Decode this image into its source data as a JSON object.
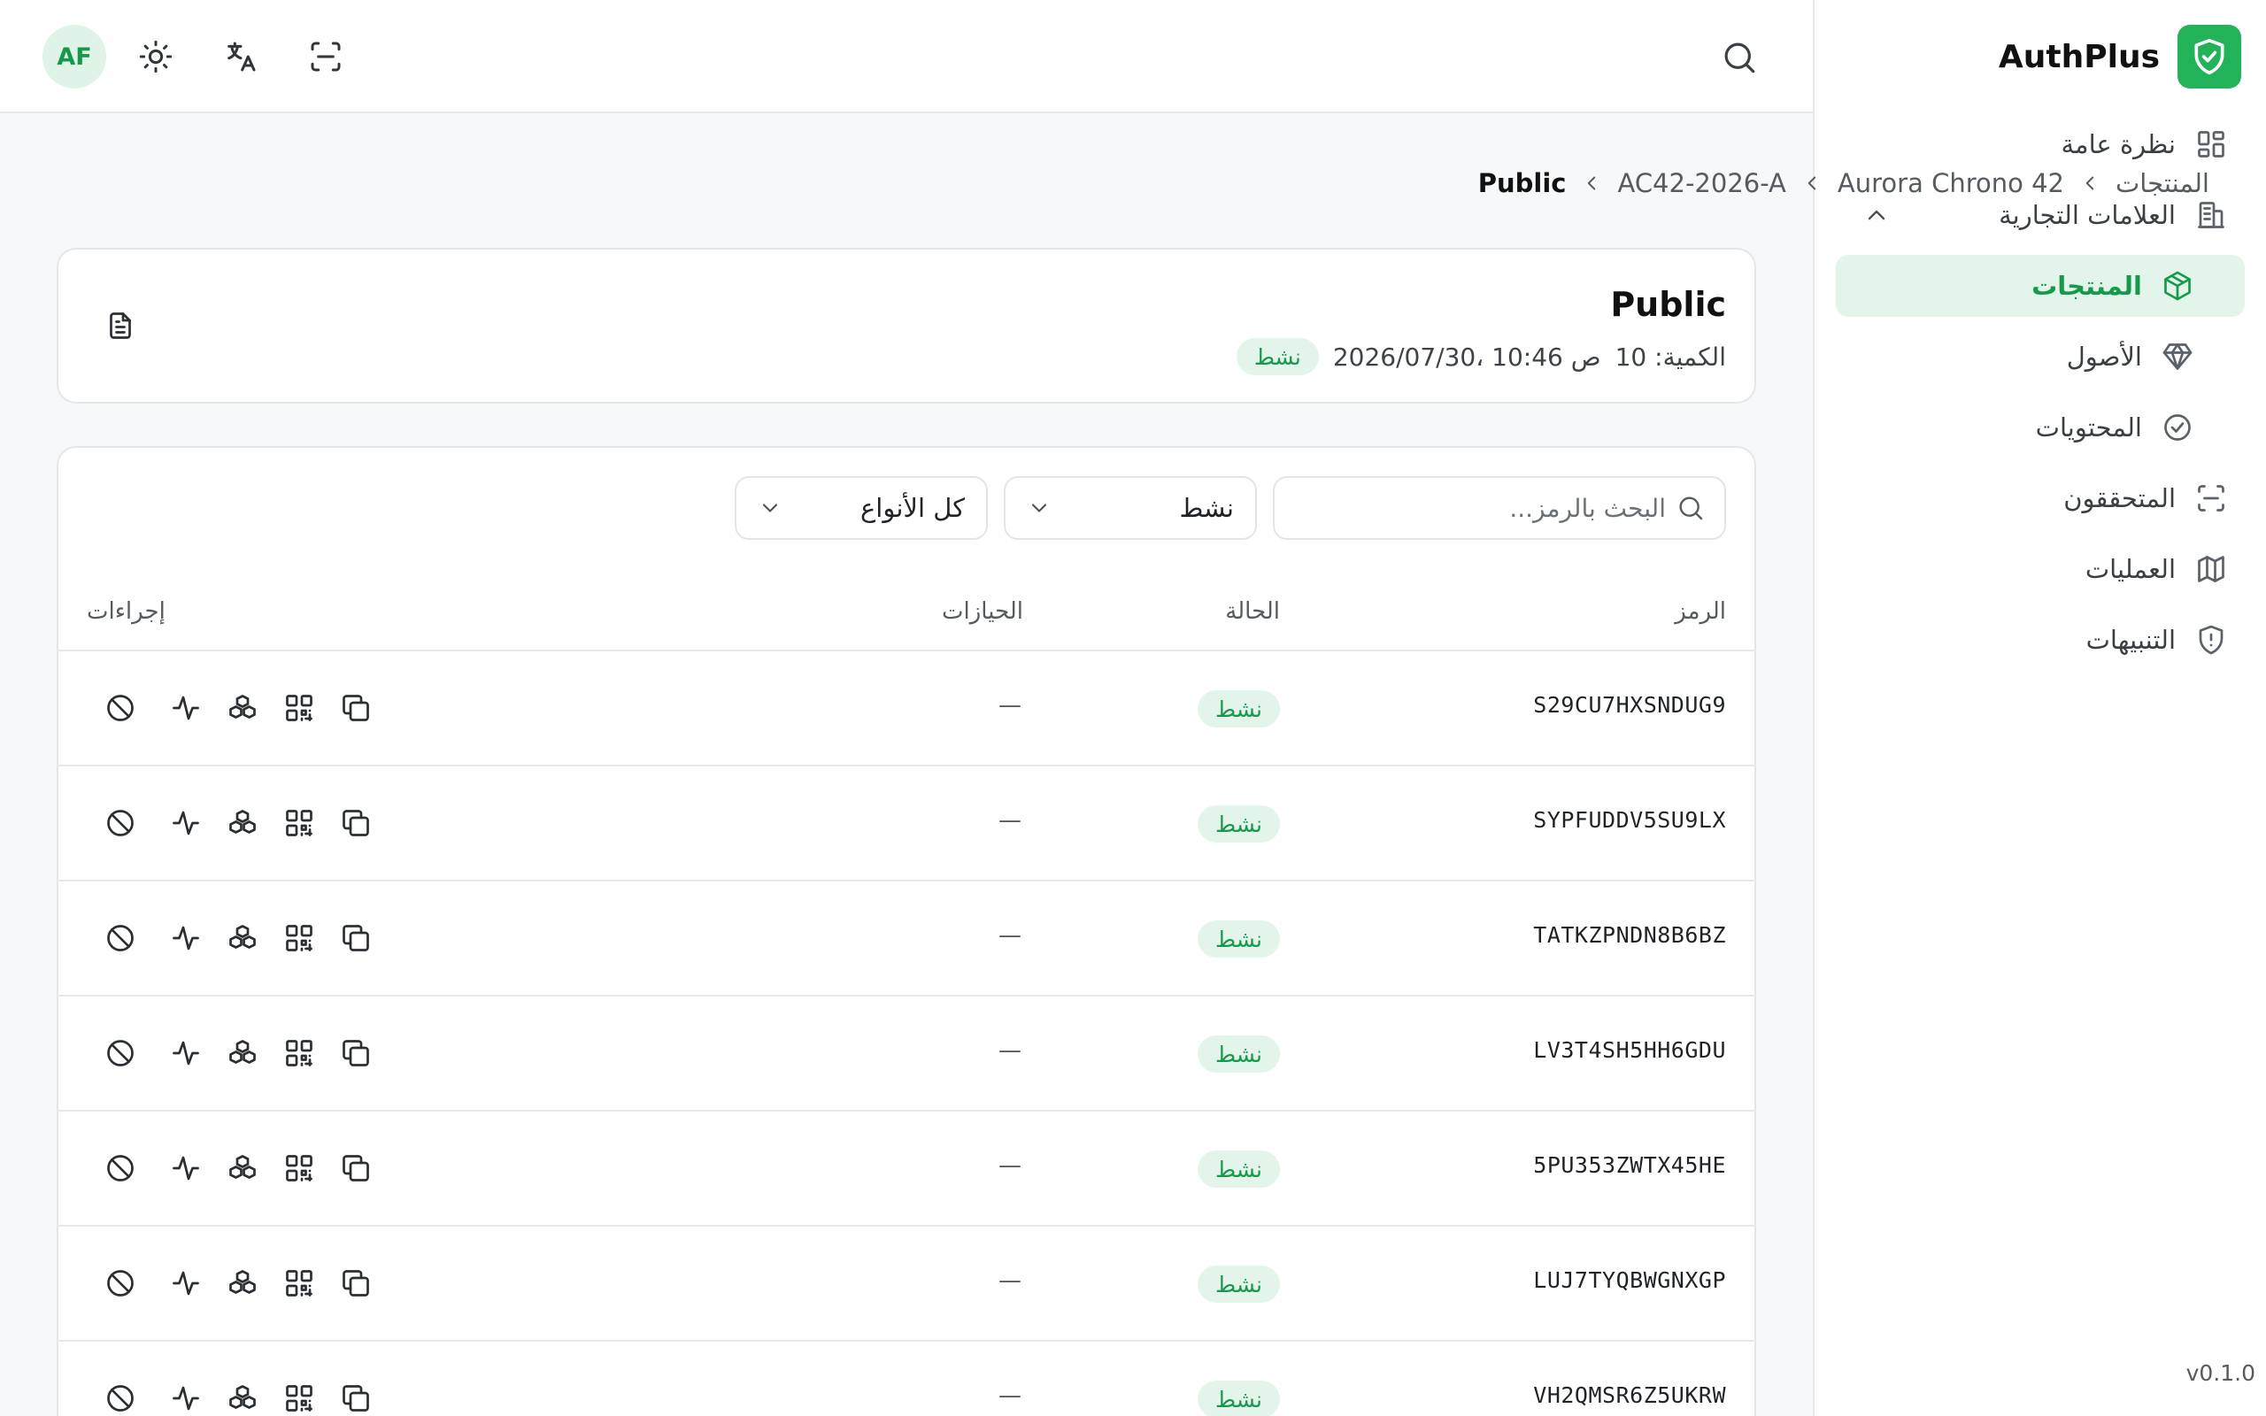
{
  "app": {
    "name": "AuthPlus",
    "version": "v0.1.0"
  },
  "colors": {
    "accent": "#22b25a",
    "accent_text": "#17994c",
    "accent_bg": "#e3f5ea"
  },
  "sidebar": {
    "items": [
      {
        "label": "نظرة عامة",
        "icon": "grid-icon"
      },
      {
        "label": "العلامات التجارية",
        "icon": "building-icon"
      },
      {
        "label": "المنتجات",
        "icon": "box-icon",
        "active": true
      },
      {
        "label": "الأصول",
        "icon": "gem-icon"
      },
      {
        "label": "المحتويات",
        "icon": "check-circle-icon"
      },
      {
        "label": "المتحققون",
        "icon": "scan-icon"
      },
      {
        "label": "العمليات",
        "icon": "map-icon"
      },
      {
        "label": "التنبيهات",
        "icon": "shield-alert-icon"
      }
    ]
  },
  "topbar": {
    "avatar": "AF"
  },
  "breadcrumb": [
    "المنتجات",
    "Aurora Chrono 42",
    "AC42-2026-A",
    "Public"
  ],
  "header": {
    "title": "Public",
    "quantity": "الكمية: 10",
    "datetime": "2026/07/30، 10:46 ص",
    "status": "نشط"
  },
  "filters": {
    "search_placeholder": "البحث بالرمز...",
    "status_value": "نشط",
    "type_value": "كل الأنواع"
  },
  "table": {
    "columns": {
      "code": "الرمز",
      "status": "الحالة",
      "holdings": "الحيازات",
      "actions": "إجراءات"
    },
    "rows": [
      {
        "code": "S29CU7HXSNDUG9",
        "status": "نشط",
        "holdings": "—"
      },
      {
        "code": "SYPFUDDV5SU9LX",
        "status": "نشط",
        "holdings": "—"
      },
      {
        "code": "TATKZPNDN8B6BZ",
        "status": "نشط",
        "holdings": "—"
      },
      {
        "code": "LV3T4SH5HH6GDU",
        "status": "نشط",
        "holdings": "—"
      },
      {
        "code": "5PU353ZWTX45HE",
        "status": "نشط",
        "holdings": "—"
      },
      {
        "code": "LUJ7TYQBWGNXGP",
        "status": "نشط",
        "holdings": "—"
      },
      {
        "code": "VH2QMSR6Z5UKRW",
        "status": "نشط",
        "holdings": "—"
      }
    ]
  }
}
